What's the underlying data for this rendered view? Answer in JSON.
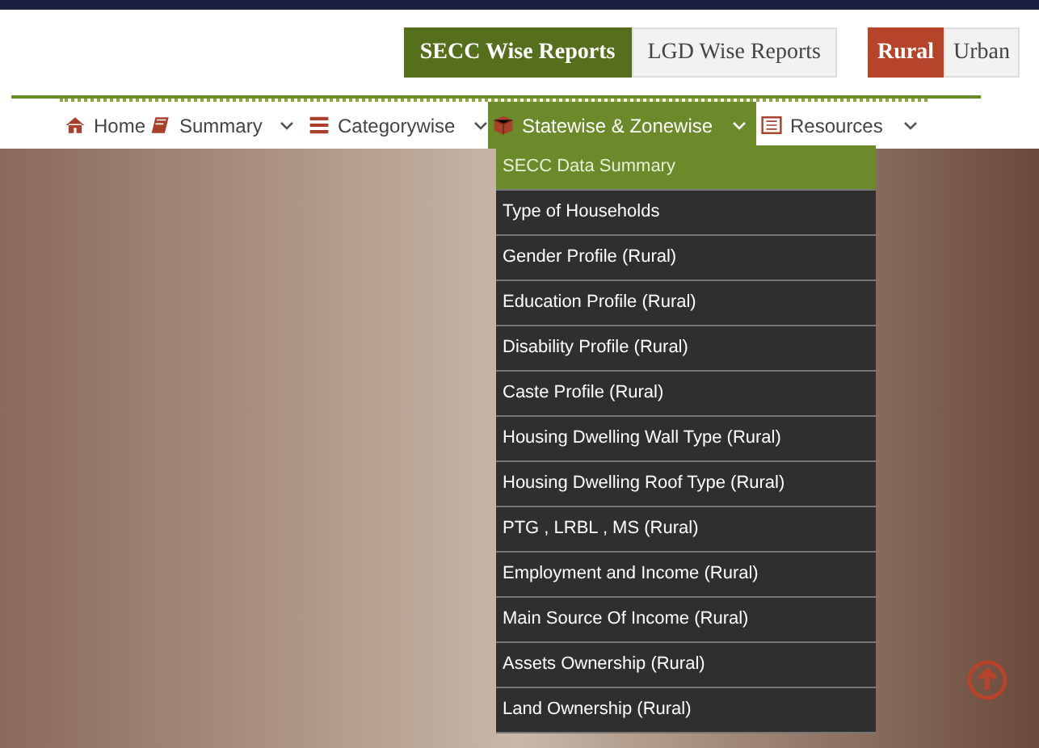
{
  "report_tabs": [
    {
      "label": "SECC Wise Reports",
      "selected": true
    },
    {
      "label": "LGD Wise Reports",
      "selected": false
    }
  ],
  "area_tabs": [
    {
      "label": "Rural",
      "selected": true
    },
    {
      "label": "Urban",
      "selected": false
    }
  ],
  "nav": [
    {
      "label": "Home",
      "selected": false,
      "caret": false
    },
    {
      "label": "Summary",
      "selected": false,
      "caret": true
    },
    {
      "label": "Categorywise",
      "selected": false,
      "caret": true
    },
    {
      "label": "Statewise & Zonewise",
      "selected": true,
      "caret": true
    },
    {
      "label": "Resources",
      "selected": false,
      "caret": true
    }
  ],
  "dropdown": [
    {
      "label": "SECC Data Summary",
      "selected": true
    },
    {
      "label": "Type of Households",
      "selected": false
    },
    {
      "label": "Gender Profile (Rural)",
      "selected": false
    },
    {
      "label": "Education Profile (Rural)",
      "selected": false
    },
    {
      "label": "Disability Profile (Rural)",
      "selected": false
    },
    {
      "label": "Caste Profile (Rural)",
      "selected": false
    },
    {
      "label": "Housing Dwelling Wall Type (Rural)",
      "selected": false
    },
    {
      "label": "Housing Dwelling Roof Type (Rural)",
      "selected": false
    },
    {
      "label": "PTG , LRBL , MS (Rural)",
      "selected": false
    },
    {
      "label": "Employment and Income (Rural)",
      "selected": false
    },
    {
      "label": "Main Source Of Income (Rural)",
      "selected": false
    },
    {
      "label": "Assets Ownership (Rural)",
      "selected": false
    },
    {
      "label": "Land Ownership (Rural)",
      "selected": false
    }
  ]
}
